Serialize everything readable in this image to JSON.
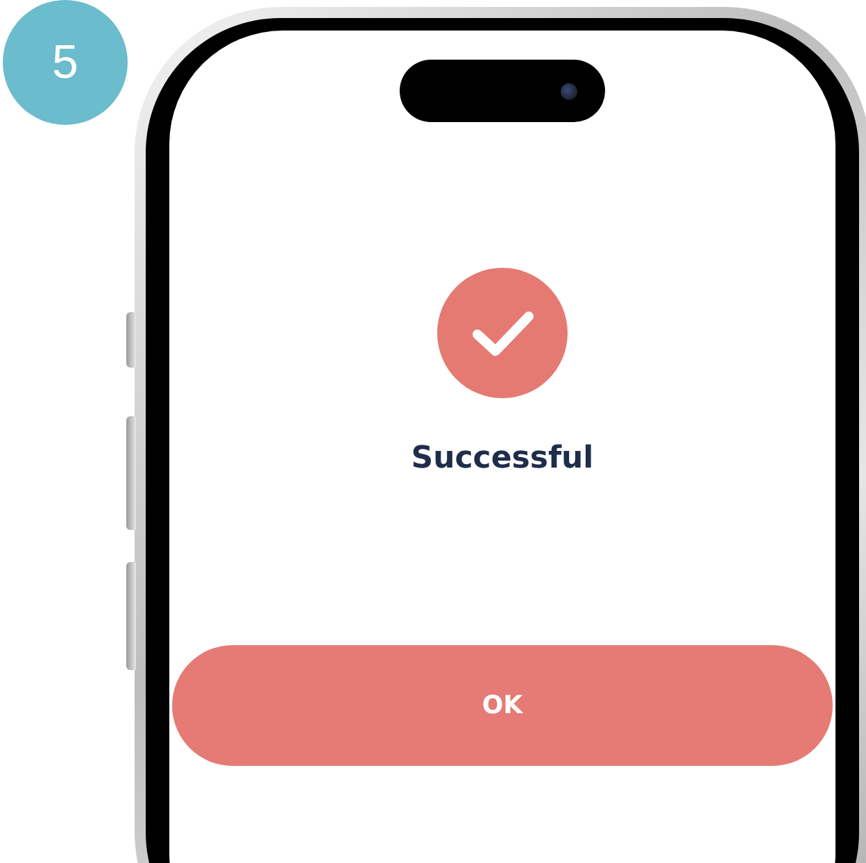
{
  "step_badge": "5",
  "screen": {
    "status_title": "Successful",
    "button": "OK"
  }
}
